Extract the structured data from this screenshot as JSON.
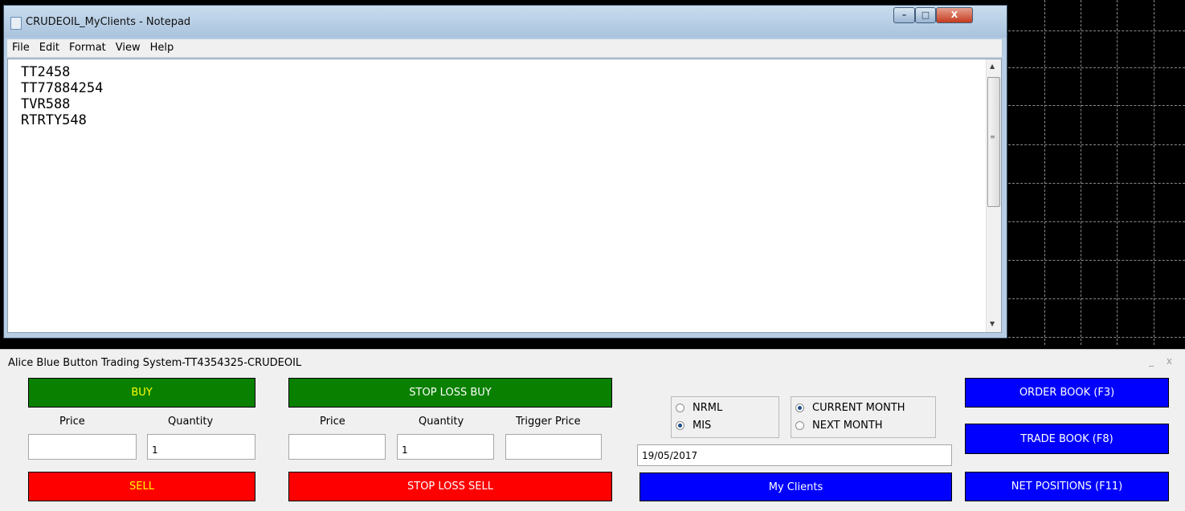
{
  "notepad": {
    "title": "CRUDEOIL_MyClients - Notepad",
    "window_buttons": {
      "minimize": "–",
      "maximize": "□",
      "close": "X"
    },
    "menu": [
      "File",
      "Edit",
      "Format",
      "View",
      "Help"
    ],
    "lines": [
      "TT2458",
      "TT77884254",
      "TVR588",
      "RTRTY548"
    ],
    "scroll_up": "▲",
    "scroll_down": "▼",
    "scroll_grip": "≡"
  },
  "panel": {
    "title": "Alice Blue Button Trading System-TT4354325-CRUDEOIL",
    "window_controls": "_ x",
    "buy_label": "BUY",
    "sell_label": "SELL",
    "stop_loss_buy_label": "STOP LOSS BUY",
    "stop_loss_sell_label": "STOP LOSS SELL",
    "price_label": "Price",
    "quantity_label": "Quantity",
    "trigger_price_label": "Trigger Price",
    "buy_price_value": "",
    "buy_quantity_value": "1",
    "sl_price_value": "",
    "sl_quantity_value": "1",
    "sl_trigger_value": "",
    "product_options": [
      {
        "label": "NRML",
        "selected": false
      },
      {
        "label": "MIS",
        "selected": true
      }
    ],
    "month_options": [
      {
        "label": "CURRENT MONTH",
        "selected": true
      },
      {
        "label": "NEXT MONTH",
        "selected": false
      }
    ],
    "date_value": "19/05/2017",
    "my_clients_label": "My Clients",
    "order_book_label": "ORDER BOOK (F3)",
    "trade_book_label": "TRADE BOOK (F8)",
    "net_positions_label": "NET POSITIONS (F11)"
  },
  "colors": {
    "buy": "#098000",
    "sell": "#ff0000",
    "action_blue": "#0000ff",
    "buy_sell_text": "#ffff00"
  }
}
